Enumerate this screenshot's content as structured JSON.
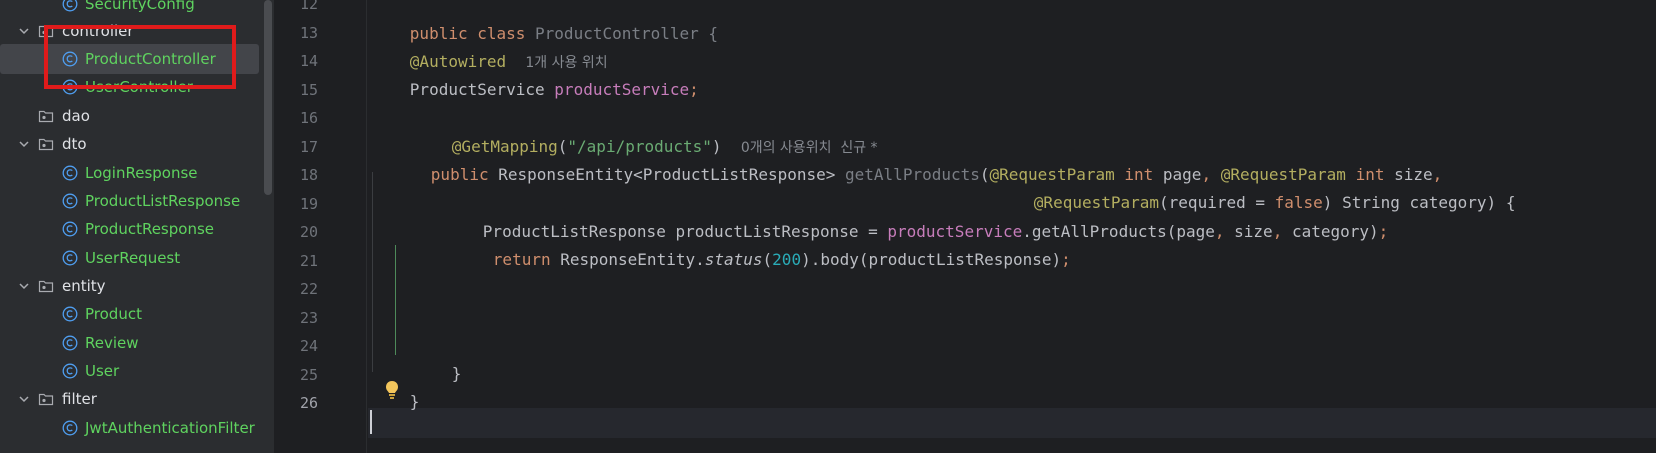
{
  "tree": {
    "items": [
      {
        "label": "SecurityConfig",
        "kind": "class"
      },
      {
        "label": "controller",
        "kind": "package",
        "expanded": true
      },
      {
        "label": "ProductController",
        "kind": "class",
        "selected": true
      },
      {
        "label": "UserController",
        "kind": "class"
      },
      {
        "label": "dao",
        "kind": "package"
      },
      {
        "label": "dto",
        "kind": "package",
        "expanded": true
      },
      {
        "label": "LoginResponse",
        "kind": "class"
      },
      {
        "label": "ProductListResponse",
        "kind": "class"
      },
      {
        "label": "ProductResponse",
        "kind": "class"
      },
      {
        "label": "UserRequest",
        "kind": "class"
      },
      {
        "label": "entity",
        "kind": "package",
        "expanded": true
      },
      {
        "label": "Product",
        "kind": "class"
      },
      {
        "label": "Review",
        "kind": "class"
      },
      {
        "label": "User",
        "kind": "class"
      },
      {
        "label": "filter",
        "kind": "package",
        "expanded": true
      },
      {
        "label": "JwtAuthenticationFilter",
        "kind": "class"
      }
    ]
  },
  "editor": {
    "line_numbers": [
      "12",
      "13",
      "14",
      "15",
      "16",
      "17",
      "18",
      "19",
      "20",
      "21",
      "22",
      "23",
      "24",
      "25",
      "26"
    ],
    "current_line": "26",
    "code": {
      "l12_kw": "public class ",
      "l12_name": "ProductController {",
      "l13_ann": "@Autowired",
      "l13_hint": "1개 사용 위치",
      "l14_type": "ProductService ",
      "l14_field": "productService",
      "l14_semi": ";",
      "l16_ann": "@GetMapping",
      "l16_p1": "(",
      "l16_str": "\"/api/products\"",
      "l16_p2": ")",
      "l16_hint": "0개의 사용위치  신규 *",
      "l17_kw": "public ",
      "l17_type": "ResponseEntity<ProductListResponse> ",
      "l17_method": "getAllProducts",
      "l17_p": "(",
      "l17_ann1": "@RequestParam ",
      "l17_int1": "int ",
      "l17_page": "page",
      "l17_c1": ", ",
      "l17_ann2": "@RequestParam ",
      "l17_int2": "int ",
      "l17_size": "size",
      "l17_c2": ",",
      "l18_ann": "@RequestParam",
      "l18_a": "(required = ",
      "l18_false": "false",
      "l18_b": ") String category) {",
      "l19_a": "ProductListResponse productListResponse = ",
      "l19_field": "productService",
      "l19_b": ".getAllProducts(page",
      "l19_c1": ", ",
      "l19_size": "size",
      "l19_c2": ", ",
      "l19_cat": "category)",
      "l19_semi": ";",
      "l20_kw": "return ",
      "l20_a": "ResponseEntity.",
      "l20_status": "status",
      "l20_p": "(",
      "l20_num": "200",
      "l20_b": ").body(productListResponse)",
      "l20_semi": ";",
      "l24": "}",
      "l25": "}"
    }
  },
  "colors": {
    "class_label": "#5fd35f",
    "keyword": "#cf8e6d",
    "annotation": "#b3ae60",
    "string": "#6aab73",
    "field": "#c77dbb",
    "number": "#2aacb8",
    "highlight_box": "#e01b1b"
  }
}
